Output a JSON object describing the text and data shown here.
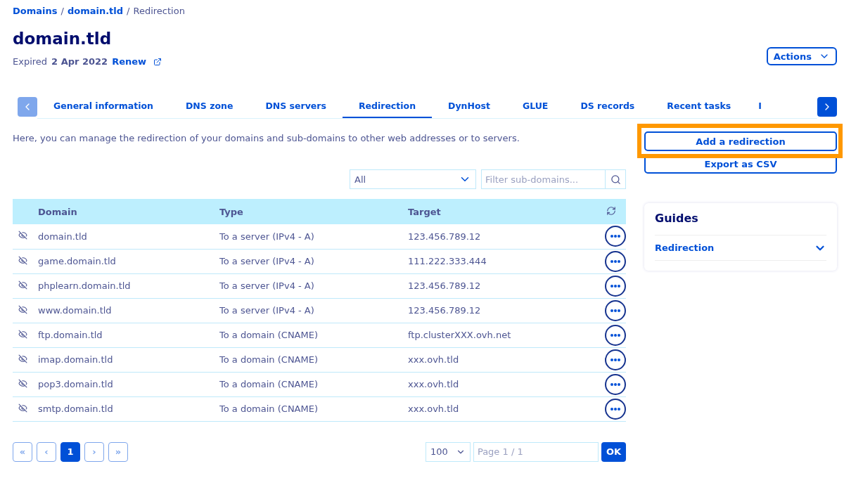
{
  "breadcrumb": [
    {
      "kind": "link",
      "label": "Domains"
    },
    {
      "kind": "separator",
      "label": "/"
    },
    {
      "kind": "link",
      "label": "domain.tld"
    },
    {
      "kind": "separator",
      "label": "/"
    },
    {
      "kind": "current",
      "label": "Redirection"
    }
  ],
  "title": "domain.tld",
  "status": {
    "label": "Expired",
    "date": "2 Apr 2022",
    "action": "Renew"
  },
  "actions_button": "Actions",
  "tabs": [
    {
      "label": "General information",
      "selected": false
    },
    {
      "label": "DNS zone",
      "selected": false
    },
    {
      "label": "DNS servers",
      "selected": false
    },
    {
      "label": "Redirection",
      "selected": true
    },
    {
      "label": "DynHost",
      "selected": false
    },
    {
      "label": "GLUE",
      "selected": false
    },
    {
      "label": "DS records",
      "selected": false
    },
    {
      "label": "Recent tasks",
      "selected": false
    },
    {
      "label": "I",
      "selected": false
    }
  ],
  "description": "Here, you can manage the redirection of your domains and sub-domains to other web addresses or to servers.",
  "filter": {
    "type_value": "All",
    "search_placeholder": "Filter sub-domains..."
  },
  "table": {
    "columns": [
      "Domain",
      "Type",
      "Target"
    ],
    "rows": [
      {
        "domain": "domain.tld",
        "type": "To a server (IPv4 - A)",
        "target": "123.456.789.12"
      },
      {
        "domain": "game.domain.tld",
        "type": "To a server (IPv4 - A)",
        "target": "111.222.333.444"
      },
      {
        "domain": "phplearn.domain.tld",
        "type": "To a server (IPv4 - A)",
        "target": "123.456.789.12"
      },
      {
        "domain": "www.domain.tld",
        "type": "To a server (IPv4 - A)",
        "target": "123.456.789.12"
      },
      {
        "domain": "ftp.domain.tld",
        "type": "To a domain (CNAME)",
        "target": "ftp.clusterXXX.ovh.net"
      },
      {
        "domain": "imap.domain.tld",
        "type": "To a domain (CNAME)",
        "target": "xxx.ovh.tld"
      },
      {
        "domain": "pop3.domain.tld",
        "type": "To a domain (CNAME)",
        "target": "xxx.ovh.tld"
      },
      {
        "domain": "smtp.domain.tld",
        "type": "To a domain (CNAME)",
        "target": "xxx.ovh.tld"
      }
    ]
  },
  "pagination": {
    "first": "«",
    "prev": "‹",
    "pages": [
      {
        "label": "1",
        "selected": true
      }
    ],
    "next": "›",
    "last": "»",
    "page_size": "100",
    "page_placeholder": "Page 1 / 1",
    "ok": "OK"
  },
  "side_buttons": [
    {
      "label": "Add a redirection",
      "highlighted": true
    },
    {
      "label": "Export as CSV",
      "highlighted": false
    }
  ],
  "guides": {
    "title": "Guides",
    "items": [
      {
        "label": "Redirection",
        "expanded": false
      }
    ]
  }
}
